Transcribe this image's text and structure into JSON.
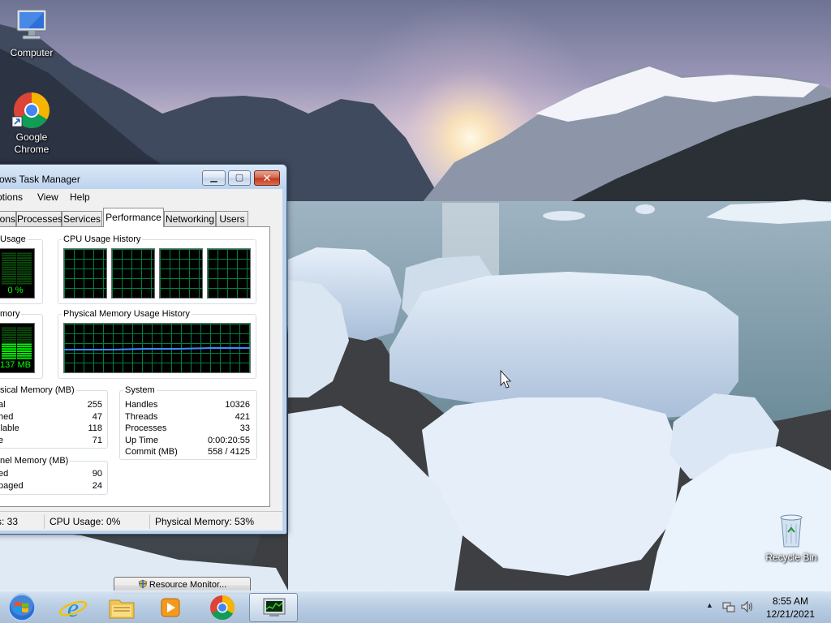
{
  "desktop": {
    "icons": [
      {
        "name": "computer",
        "label": "Computer"
      },
      {
        "name": "google-chrome",
        "label": "Google Chrome"
      },
      {
        "name": "recycle-bin",
        "label": "Recycle Bin"
      }
    ]
  },
  "task_manager": {
    "title": "ows Task Manager",
    "menu": [
      "ptions",
      "View",
      "Help"
    ],
    "tabs": [
      "ions",
      "Processes",
      "Services",
      "Performance",
      "Networking",
      "Users"
    ],
    "active_tab": "Performance",
    "cpu_usage": {
      "label": "Usage",
      "value": "0 %",
      "level": 0.0
    },
    "cpu_history": {
      "label": "CPU Usage History"
    },
    "memory": {
      "label": "mory",
      "value": "137 MB",
      "level": 0.53
    },
    "memory_history": {
      "label": "Physical Memory Usage History"
    },
    "physical_memory": {
      "label": "sical Memory (MB)",
      "rows": [
        {
          "k": "al",
          "v": "255"
        },
        {
          "k": "hed",
          "v": "47"
        },
        {
          "k": "ilable",
          "v": "118"
        },
        {
          "k": "e",
          "v": "71"
        }
      ]
    },
    "kernel_memory": {
      "label": "nel Memory (MB)",
      "rows": [
        {
          "k": "ed",
          "v": "90"
        },
        {
          "k": "paged",
          "v": "24"
        }
      ]
    },
    "system": {
      "label": "System",
      "rows": [
        {
          "k": "Handles",
          "v": "10326"
        },
        {
          "k": "Threads",
          "v": "421"
        },
        {
          "k": "Processes",
          "v": "33"
        },
        {
          "k": "Up Time",
          "v": "0:00:20:55"
        },
        {
          "k": "Commit (MB)",
          "v": "558 / 4125"
        }
      ]
    },
    "resource_monitor_label": "Resource Monitor...",
    "status": {
      "processes": "s: 33",
      "cpu": "CPU Usage: 0%",
      "memory": "Physical Memory: 53%"
    },
    "caption_buttons": {
      "minimize": "minimize-icon",
      "maximize": "maximize-icon",
      "close": "close-icon"
    }
  },
  "taskbar": {
    "start_icon": "windows-start-icon",
    "pinned": [
      "internet-explorer-icon",
      "file-explorer-icon",
      "media-player-icon",
      "chrome-icon",
      "task-manager-icon"
    ],
    "tray_icons": [
      "show-hidden-icons-arrow",
      "network-icon",
      "volume-icon"
    ],
    "clock_time": "8:55 AM",
    "clock_date": "12/21/2021"
  },
  "colors": {
    "graph_bg": "#000000",
    "graph_green": "#00ff00",
    "grid": "#008040",
    "memory_line": "#3f8cff",
    "taskbar": "#b6cbe2"
  }
}
